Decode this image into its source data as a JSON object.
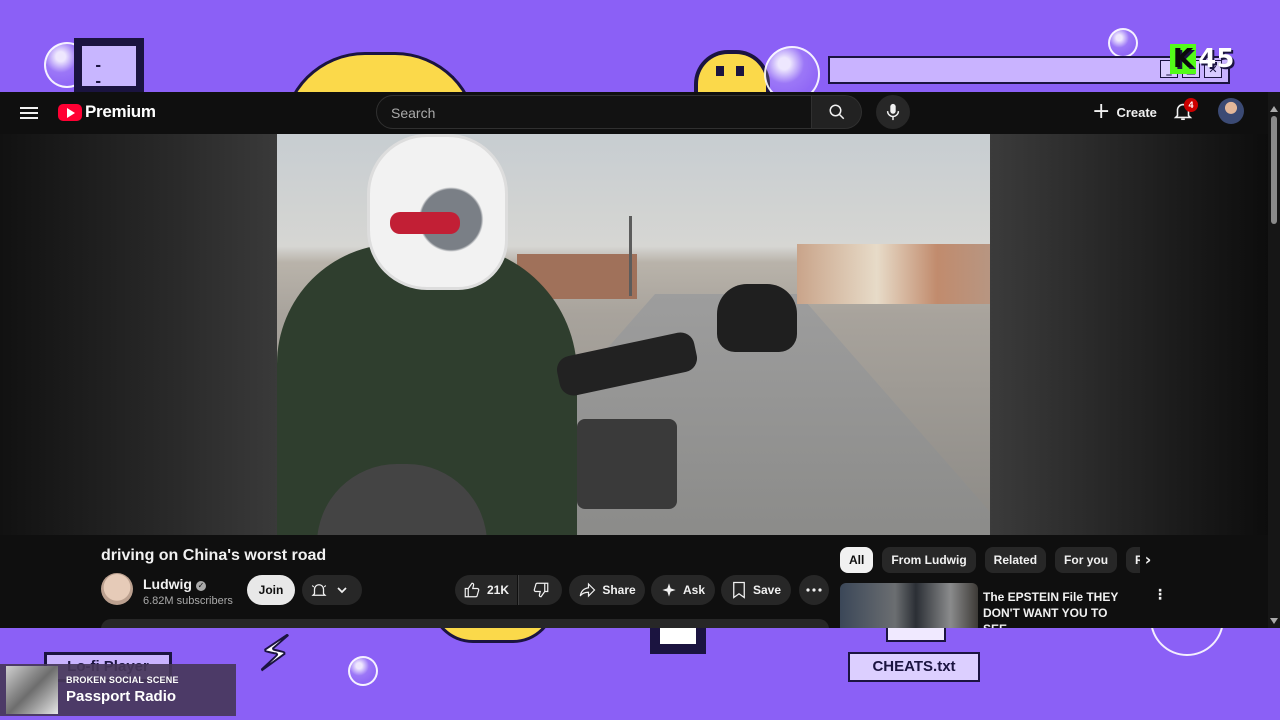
{
  "desktop": {
    "overlay_left_label": "Lo-fi Player",
    "overlay_file_label": "CHEATS.txt",
    "kick_counter": "45",
    "kick_logo_letter": "K",
    "music": {
      "artist": "BROKEN SOCIAL SCENE",
      "title": "Passport Radio"
    },
    "colors": {
      "background": "#8b60f6",
      "accent_yellow": "#fbd94a",
      "kick_green": "#53fc18"
    }
  },
  "youtube": {
    "brand": "Premium",
    "search": {
      "placeholder": "Search",
      "value": ""
    },
    "create_label": "Create",
    "notification_count": "4",
    "icons": [
      "menu-icon",
      "youtube-logo-icon",
      "search-icon",
      "mic-icon",
      "plus-icon",
      "bell-icon",
      "avatar"
    ],
    "video": {
      "title": "driving on China's worst road",
      "channel": "Ludwig",
      "subscribers": "6.82M subscribers",
      "join_label": "Join",
      "like_count": "21K",
      "share_label": "Share",
      "ask_label": "Ask",
      "save_label": "Save"
    },
    "chips": [
      "All",
      "From Ludwig",
      "Related",
      "For you",
      "Re"
    ],
    "recommendation": {
      "title": "The EPSTEIN File THEY DON'T WANT YOU TO SEE..."
    },
    "colors": {
      "background": "#0f0f0f",
      "brand_red": "#ff0033",
      "badge_red": "#cc0000"
    }
  }
}
